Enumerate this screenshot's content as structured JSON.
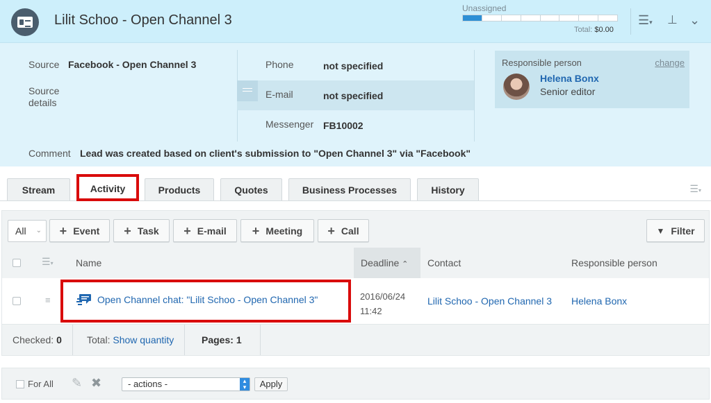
{
  "header": {
    "title": "Lilit Schoo - Open Channel 3",
    "progress_label": "Unassigned",
    "progress_segments_filled": 1,
    "progress_segments_total": 8,
    "total_label": "Total:",
    "total_value": "$0.00",
    "icons": [
      "list-settings-icon",
      "pin-icon",
      "chevron-down-icon"
    ]
  },
  "info": {
    "source_label": "Source",
    "source_value": "Facebook - Open Channel 3",
    "source_details_label_1": "Source",
    "source_details_label_2": "details",
    "phone_label": "Phone",
    "phone_value": "not specified",
    "email_label": "E-mail",
    "email_value": "not specified",
    "messenger_label": "Messenger",
    "messenger_value": "FB10002",
    "comment_label": "Comment",
    "comment_value": "Lead was created based on client's submission to \"Open Channel 3\" via \"Facebook\"",
    "responsible": {
      "title": "Responsible person",
      "change_label": "change",
      "name": "Helena Bonx",
      "position": "Senior editor"
    }
  },
  "tabs": [
    {
      "label": "Stream"
    },
    {
      "label": "Activity",
      "active": true
    },
    {
      "label": "Products"
    },
    {
      "label": "Quotes"
    },
    {
      "label": "Business Processes"
    },
    {
      "label": "History"
    }
  ],
  "toolbar": {
    "filter_select": "All",
    "buttons": [
      "Event",
      "Task",
      "E-mail",
      "Meeting",
      "Call"
    ],
    "filter_label": "Filter"
  },
  "grid": {
    "columns": [
      "Name",
      "Deadline",
      "Contact",
      "Responsible person"
    ],
    "sort_column": "Deadline",
    "rows": [
      {
        "name": "Open Channel chat: \"Lilit Schoo - Open Channel 3\"",
        "deadline_date": "2016/06/24",
        "deadline_time": "11:42",
        "contact": "Lilit Schoo - Open Channel 3",
        "responsible": "Helena Bonx"
      }
    ]
  },
  "footer": {
    "checked_label": "Checked:",
    "checked_value": "0",
    "total_label": "Total:",
    "total_link": "Show quantity",
    "pages_label": "Pages:",
    "pages_value": "1"
  },
  "actions": {
    "for_all_label": "For All",
    "select_value": "- actions -",
    "apply_label": "Apply"
  },
  "colors": {
    "header_bg": "#cdeffb",
    "info_bg": "#dff3fb",
    "link": "#2067b0",
    "annotation": "#d90b0b",
    "progress_fill": "#2c8fd5"
  }
}
